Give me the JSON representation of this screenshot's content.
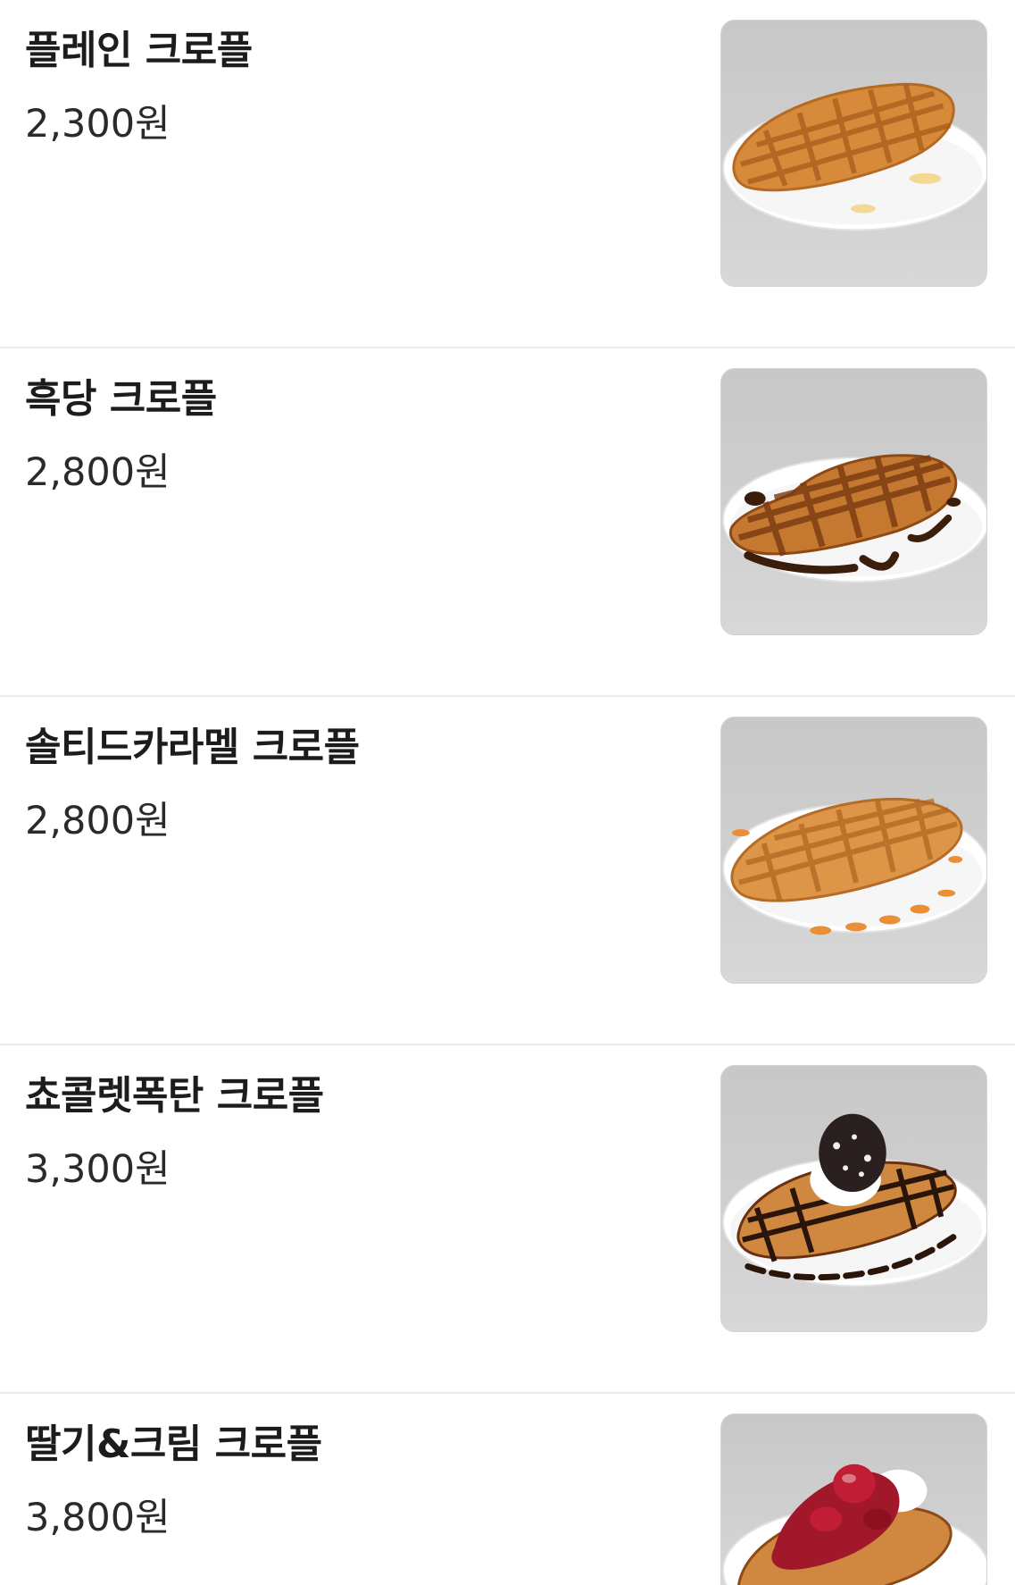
{
  "menu": {
    "items": [
      {
        "name": "플레인 크로플",
        "price": "2,300원",
        "image": "plain-croffle-photo"
      },
      {
        "name": "흑당 크로플",
        "price": "2,800원",
        "image": "brown-sugar-croffle-photo"
      },
      {
        "name": "솔티드카라멜 크로플",
        "price": "2,800원",
        "image": "salted-caramel-croffle-photo"
      },
      {
        "name": "쵸콜렛폭탄 크로플",
        "price": "3,300원",
        "image": "chocolate-bomb-croffle-photo"
      },
      {
        "name": "딸기&크림 크로플",
        "price": "3,800원",
        "image": "strawberry-cream-croffle-photo"
      }
    ]
  },
  "colors": {
    "background": "#ffffff",
    "divider": "#ebebeb",
    "waffle": "#d98a3a",
    "brown_sugar": "#3b1d0c",
    "caramel": "#e8933f",
    "chocolate": "#2a150a",
    "strawberry": "#a0182a",
    "cream": "#ffffff"
  }
}
